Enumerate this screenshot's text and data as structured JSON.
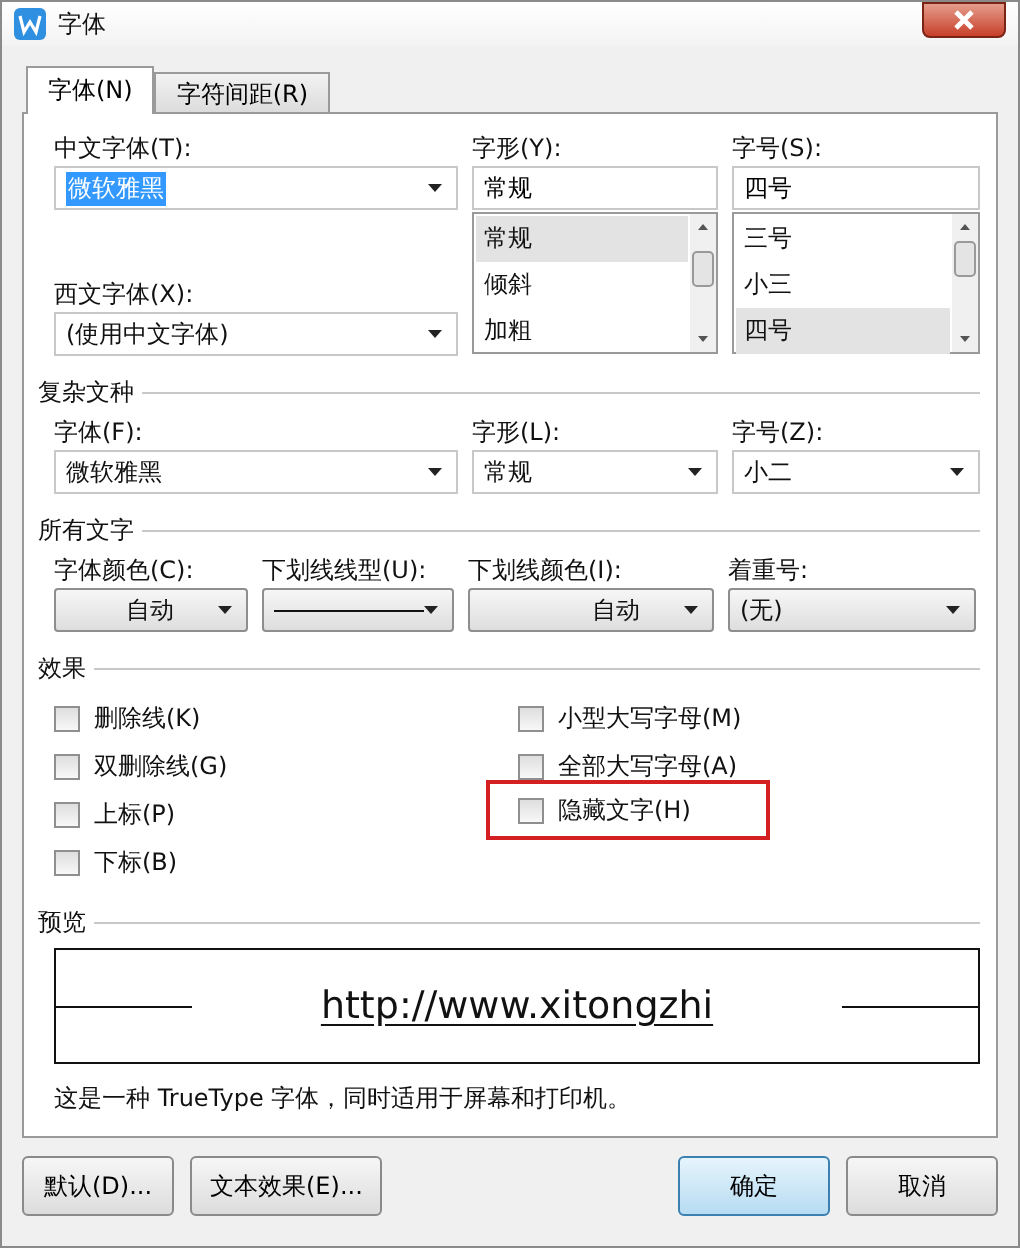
{
  "window": {
    "title": "字体"
  },
  "tabs": [
    {
      "label": "字体(N)",
      "selected": true
    },
    {
      "label": "字符间距(R)",
      "selected": false
    }
  ],
  "font": {
    "chinese_font": {
      "label": "中文字体(T):",
      "value": "微软雅黑",
      "text_selected": true
    },
    "western_font": {
      "label": "西文字体(X):",
      "value": "(使用中文字体)"
    },
    "style": {
      "label": "字形(Y):",
      "value": "常规",
      "options": [
        {
          "label": "常规",
          "selected": true
        },
        {
          "label": "倾斜",
          "selected": false
        },
        {
          "label": "加粗",
          "selected": false
        }
      ]
    },
    "size": {
      "label": "字号(S):",
      "value": "四号",
      "options": [
        {
          "label": "三号",
          "selected": false
        },
        {
          "label": "小三",
          "selected": false
        },
        {
          "label": "四号",
          "selected": true
        }
      ]
    }
  },
  "complex_script": {
    "title": "复杂文种",
    "fields": [
      {
        "label": "字体(F):",
        "value": "微软雅黑"
      },
      {
        "label": "字形(L):",
        "value": "常规"
      },
      {
        "label": "字号(Z):",
        "value": "小二"
      }
    ]
  },
  "all_text": {
    "title": "所有文字",
    "fields": [
      {
        "label": "字体颜色(C):",
        "kind": "button",
        "value": "自动"
      },
      {
        "label": "下划线线型(U):",
        "kind": "line"
      },
      {
        "label": "下划线颜色(I):",
        "kind": "button",
        "value": "自动"
      },
      {
        "label": "着重号:",
        "kind": "dropdown",
        "value": "(无)"
      }
    ]
  },
  "effects": {
    "title": "效果",
    "left": [
      {
        "label": "删除线(K)",
        "checked": false,
        "highlighted": false
      },
      {
        "label": "双删除线(G)",
        "checked": false,
        "highlighted": false
      },
      {
        "label": "上标(P)",
        "checked": false,
        "highlighted": false
      },
      {
        "label": "下标(B)",
        "checked": false,
        "highlighted": false
      }
    ],
    "right": [
      {
        "label": "小型大写字母(M)",
        "checked": false,
        "highlighted": false
      },
      {
        "label": "全部大写字母(A)",
        "checked": false,
        "highlighted": false
      },
      {
        "label": "隐藏文字(H)",
        "checked": false,
        "highlighted": true
      }
    ]
  },
  "preview": {
    "title": "预览",
    "sample": "http://www.xitongzhi",
    "note": "这是一种 TrueType 字体，同时适用于屏幕和打印机。"
  },
  "buttons": [
    {
      "label": "默认(D)...",
      "kind": "normal"
    },
    {
      "label": "文本效果(E)...",
      "kind": "normal"
    },
    {
      "label": "确定",
      "kind": "default"
    },
    {
      "label": "取消",
      "kind": "normal"
    }
  ]
}
